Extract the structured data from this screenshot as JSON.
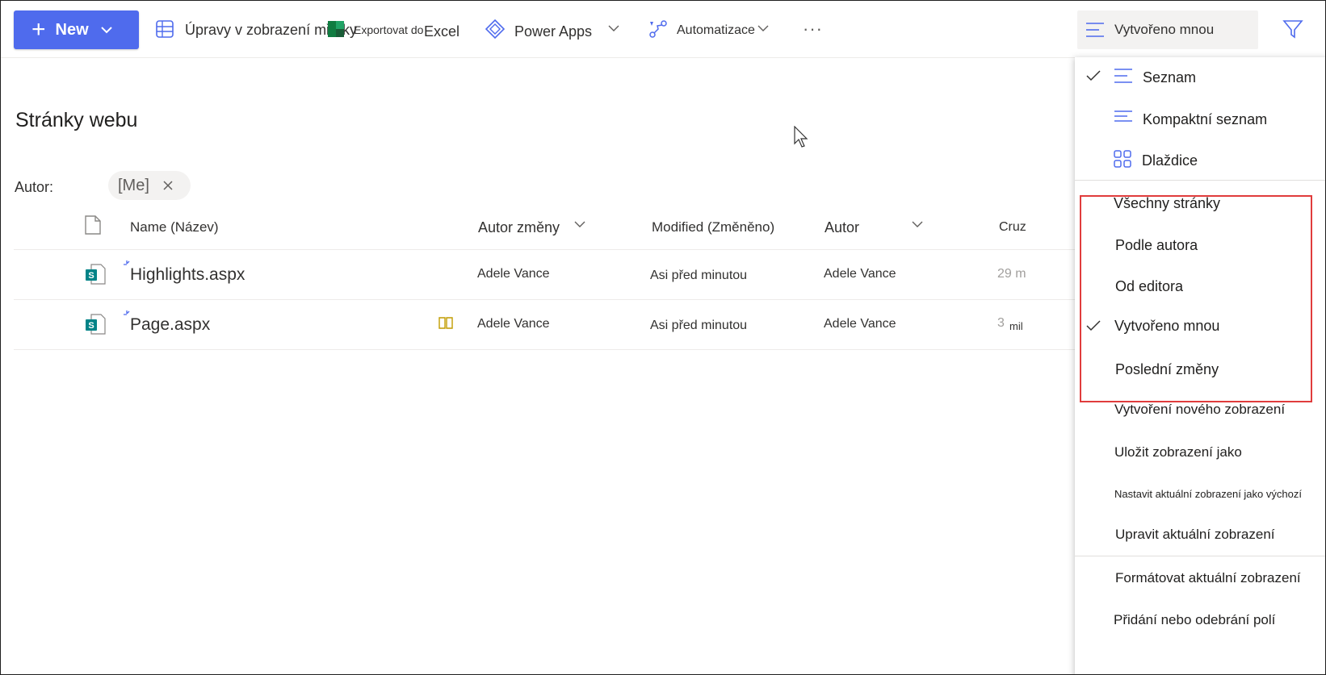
{
  "commandbar": {
    "new_label": "New",
    "grid_edit_label": "Úpravy v zobrazení mřížky",
    "export_prefix": "Exportovat do",
    "export_excel": "Excel",
    "power_apps_label": "Power Apps",
    "automate_label": "Automatizace",
    "current_view_label": "Vytvořeno mnou"
  },
  "page": {
    "title": "Stránky webu",
    "filter_label": "Autor:",
    "filter_value": "[Me]"
  },
  "table": {
    "columns": {
      "name": "Name (Název)",
      "modified_by": "Autor změny",
      "modified": "Modified (Změněno)",
      "author": "Autor",
      "created": "Cruz"
    },
    "rows": [
      {
        "name": "Highlights.aspx",
        "modified_by": "Adele Vance",
        "modified": "Asi před minutou",
        "author": "Adele Vance",
        "created": "29 m"
      },
      {
        "name": "Page.aspx",
        "modified_by": "Adele Vance",
        "modified": "Asi před minutou",
        "author": "Adele Vance",
        "created": "3",
        "created_suffix": "mil"
      }
    ]
  },
  "menu": {
    "layout": [
      {
        "label": "Seznam",
        "checked": true
      },
      {
        "label": "Kompaktní seznam",
        "checked": false
      },
      {
        "label": "Dlaždice",
        "checked": false
      }
    ],
    "views": [
      {
        "label": "Všechny stránky",
        "checked": false
      },
      {
        "label": "Podle autora",
        "checked": false
      },
      {
        "label": "Od editora",
        "checked": false
      },
      {
        "label": "Vytvořeno mnou",
        "checked": true
      },
      {
        "label": "Poslední změny",
        "checked": false
      }
    ],
    "actions": [
      "Vytvoření nového zobrazení",
      "Uložit zobrazení jako",
      "Nastavit aktuální zobrazení jako výchozí",
      "Upravit aktuální zobrazení"
    ],
    "format_actions": [
      "Formátovat aktuální zobrazení",
      "Přidání nebo odebrání polí"
    ]
  },
  "colors": {
    "accent": "#4f6bed",
    "highlight_box": "#e03c3c",
    "excel_green": "#107c41",
    "sharepoint_teal": "#038387"
  }
}
